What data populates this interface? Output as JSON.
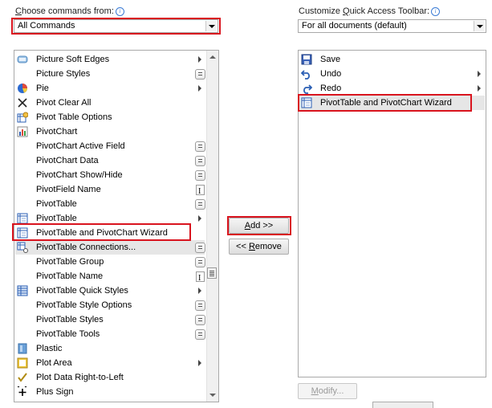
{
  "left_panel": {
    "choose_label_prefix": "",
    "choose_label_u": "C",
    "choose_label_rest": "hoose commands from:",
    "combo_value": "All Commands",
    "commands": [
      {
        "label": "Picture Soft Edges",
        "icon": "picture-soft-edges-icon",
        "suffix": "submenu-arrow"
      },
      {
        "label": "Picture Styles",
        "icon": "none",
        "suffix": "gallery-button"
      },
      {
        "label": "Pie",
        "icon": "pie-chart-icon",
        "suffix": "submenu-arrow"
      },
      {
        "label": "Pivot Clear All",
        "icon": "clear-x-icon",
        "suffix": "none"
      },
      {
        "label": "Pivot Table Options",
        "icon": "pivot-options-icon",
        "suffix": "none"
      },
      {
        "label": "PivotChart",
        "icon": "pivotchart-icon",
        "suffix": "none"
      },
      {
        "label": "PivotChart Active Field",
        "icon": "none",
        "suffix": "gallery-button"
      },
      {
        "label": "PivotChart Data",
        "icon": "none",
        "suffix": "gallery-button"
      },
      {
        "label": "PivotChart Show/Hide",
        "icon": "none",
        "suffix": "gallery-button"
      },
      {
        "label": "PivotField Name",
        "icon": "none",
        "suffix": "text-field"
      },
      {
        "label": "PivotTable",
        "icon": "none",
        "suffix": "gallery-button"
      },
      {
        "label": "PivotTable",
        "icon": "pivottable-icon",
        "suffix": "submenu-arrow"
      },
      {
        "label": "PivotTable and PivotChart Wizard",
        "icon": "pivot-wizard-icon",
        "suffix": "none"
      },
      {
        "label": "PivotTable Connections...",
        "icon": "pivot-connections-icon",
        "suffix": "gallery-button"
      },
      {
        "label": "PivotTable Group",
        "icon": "none",
        "suffix": "gallery-button"
      },
      {
        "label": "PivotTable Name",
        "icon": "none",
        "suffix": "text-field"
      },
      {
        "label": "PivotTable Quick Styles",
        "icon": "quick-styles-icon",
        "suffix": "submenu-arrow"
      },
      {
        "label": "PivotTable Style Options",
        "icon": "none",
        "suffix": "gallery-button"
      },
      {
        "label": "PivotTable Styles",
        "icon": "none",
        "suffix": "gallery-button"
      },
      {
        "label": "PivotTable Tools",
        "icon": "none",
        "suffix": "gallery-button"
      },
      {
        "label": "Plastic",
        "icon": "plastic-icon",
        "suffix": "none"
      },
      {
        "label": "Plot Area",
        "icon": "plot-area-icon",
        "suffix": "submenu-arrow"
      },
      {
        "label": "Plot Data Right-to-Left",
        "icon": "checkmark-icon",
        "suffix": "none"
      },
      {
        "label": "Plus Sign",
        "icon": "plus-sign-icon",
        "suffix": "none"
      }
    ]
  },
  "middle": {
    "add_button": "Add >>",
    "add_u": "A",
    "add_rest": "dd >>",
    "remove_prefix": "<< ",
    "remove_u": "R",
    "remove_rest": "emove"
  },
  "right_panel": {
    "customize_prefix": "Customize ",
    "customize_u": "Q",
    "customize_rest": "uick Access Toolbar:",
    "combo_value": "For all documents (default)",
    "items": [
      {
        "label": "Save",
        "icon": "save-icon",
        "suffix": "none"
      },
      {
        "label": "Undo",
        "icon": "undo-icon",
        "suffix": "submenu-arrow"
      },
      {
        "label": "Redo",
        "icon": "redo-icon",
        "suffix": "submenu-arrow"
      },
      {
        "label": "PivotTable and PivotChart Wizard",
        "icon": "pivot-wizard-icon",
        "suffix": "none"
      }
    ],
    "modify_u": "M",
    "modify_rest": "odify..."
  },
  "colors": {
    "highlight": "#d9141e",
    "selection": "#e6e6e6",
    "icon_blue": "#2b5fb4"
  }
}
